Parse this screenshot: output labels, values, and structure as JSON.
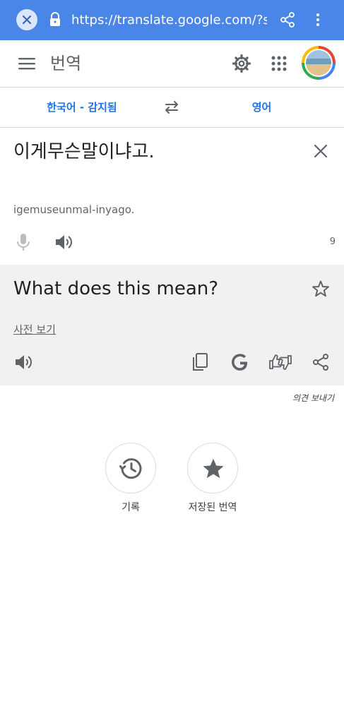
{
  "browser": {
    "url": "https://translate.google.com/?sl=au",
    "bar_color": "#4a86e8"
  },
  "app": {
    "title": "번역"
  },
  "languages": {
    "source": "한국어 - 감지됨",
    "target": "영어",
    "accent_color": "#1a73e8"
  },
  "source_panel": {
    "text": "이게무슨말이냐고.",
    "romanization": "igemuseunmal-inyago.",
    "character_count": "9"
  },
  "translation_panel": {
    "text": "What does this mean?",
    "dictionary_link": "사전 보기",
    "background_color": "#f1f1f1"
  },
  "feedback": {
    "label": "의견 보내기"
  },
  "actions": {
    "history_label": "기록",
    "saved_label": "저장된 번역"
  },
  "icons": {
    "browser_close": "close-icon",
    "browser_lock": "lock-icon",
    "browser_share": "share-icon",
    "browser_more": "more-vertical-icon",
    "menu": "menu-icon",
    "settings": "gear-icon",
    "apps": "apps-grid-icon",
    "swap": "swap-languages-icon",
    "clear_source": "close-icon",
    "microphone": "microphone-icon",
    "speaker": "speaker-icon",
    "save_translation": "star-outline-icon",
    "copy": "copy-icon",
    "google": "google-icon",
    "rate": "thumbs-rating-icon",
    "share": "share-icon",
    "history": "history-icon",
    "saved": "star-icon"
  }
}
